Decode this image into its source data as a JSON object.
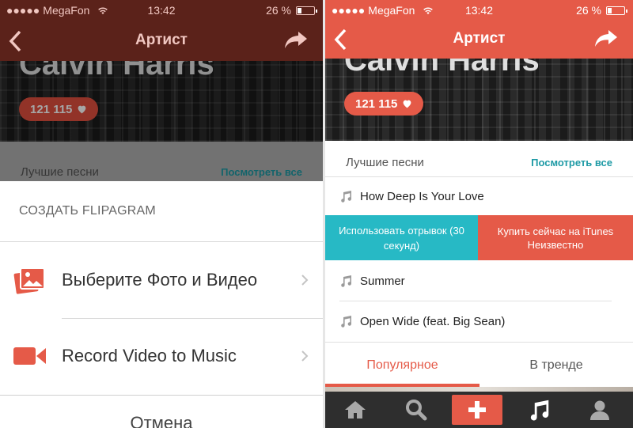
{
  "colors": {
    "accent": "#e55a48",
    "teal": "#27b9c5",
    "link": "#1e9aa5",
    "tabbar": "#2e2e2e"
  },
  "status": {
    "carrier": "MegaFon",
    "time": "13:42",
    "battery": "26 %"
  },
  "nav": {
    "title": "Артист",
    "back_icon": "chevron-left-icon",
    "share_icon": "share-arrow-icon"
  },
  "artist": {
    "name": "Calvin Harris",
    "likes": "121 115"
  },
  "top_songs": {
    "label": "Лучшие песни",
    "see_all": "Посмотреть все"
  },
  "action_sheet": {
    "title": "СОЗДАТЬ FLIPAGRAM",
    "options": [
      {
        "label": "Выберите Фото и Видео",
        "icon": "photo-stack-icon"
      },
      {
        "label": "Record Video to Music",
        "icon": "video-camera-icon"
      }
    ],
    "cancel": "Отмена"
  },
  "songs": [
    {
      "title": "How Deep Is Your Love"
    },
    {
      "title": "Summer"
    },
    {
      "title": "Open Wide (feat. Big Sean)"
    }
  ],
  "swipe_actions": {
    "preview": "Использовать отрывок (30 секунд)",
    "buy": "Купить сейчас на iTunes",
    "buy_sub": "Неизвестно"
  },
  "tabs": [
    {
      "label": "Популярное",
      "active": true
    },
    {
      "label": "В тренде",
      "active": false
    }
  ],
  "tabbar": [
    "home-icon",
    "search-icon",
    "plus-icon",
    "music-note-icon",
    "profile-icon"
  ]
}
